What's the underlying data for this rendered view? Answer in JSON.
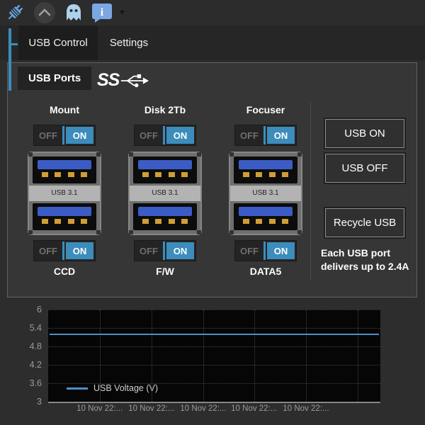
{
  "accent_color": "#3c8dbc",
  "toolbar": {
    "icons": [
      "plug-icon",
      "collapse-chevron-icon",
      "ghost-icon",
      "info-bubble-icon",
      "dropdown-caret-icon"
    ],
    "dropdown_caret": "▼"
  },
  "tabs": [
    {
      "label": "USB Control",
      "active": true
    },
    {
      "label": "Settings",
      "active": false
    }
  ],
  "usb_panel": {
    "title": "USB Ports",
    "logo_text": "SS",
    "toggle_off": "OFF",
    "toggle_on": "ON",
    "port_label": "USB 3.1",
    "columns": [
      {
        "top_label": "Mount",
        "top_state": "ON",
        "bottom_state": "ON",
        "bottom_label": "CCD"
      },
      {
        "top_label": "Disk 2Tb",
        "top_state": "ON",
        "bottom_state": "ON",
        "bottom_label": "F/W"
      },
      {
        "top_label": "Focuser",
        "top_state": "ON",
        "bottom_state": "ON",
        "bottom_label": "DATA5"
      }
    ],
    "usb_on_button": "USB ON",
    "usb_off_button": "USB OFF",
    "recycle_button": "Recycle USB",
    "note": "Each USB port delivers up to 2.4A"
  },
  "chart_data": {
    "type": "line",
    "title": "",
    "series": [
      {
        "name": "USB Voltage (V)",
        "color": "#4e8ec5",
        "values": [
          5.2,
          5.2,
          5.2,
          5.2,
          5.2
        ]
      }
    ],
    "x_labels": [
      "10 Nov 22:...",
      "10 Nov 22:...",
      "10 Nov 22:...",
      "10 Nov 22:...",
      "10 Nov 22:..."
    ],
    "x_tick_fractions": [
      0.155,
      0.311,
      0.467,
      0.62,
      0.776,
      0.932
    ],
    "y_ticks": [
      "6",
      "5.4",
      "4.8",
      "4.2",
      "3.6",
      "3"
    ],
    "ylim": [
      3,
      6
    ],
    "grid": "dotted",
    "plot_bg": "#060606",
    "legend_position": "bottom-left"
  }
}
